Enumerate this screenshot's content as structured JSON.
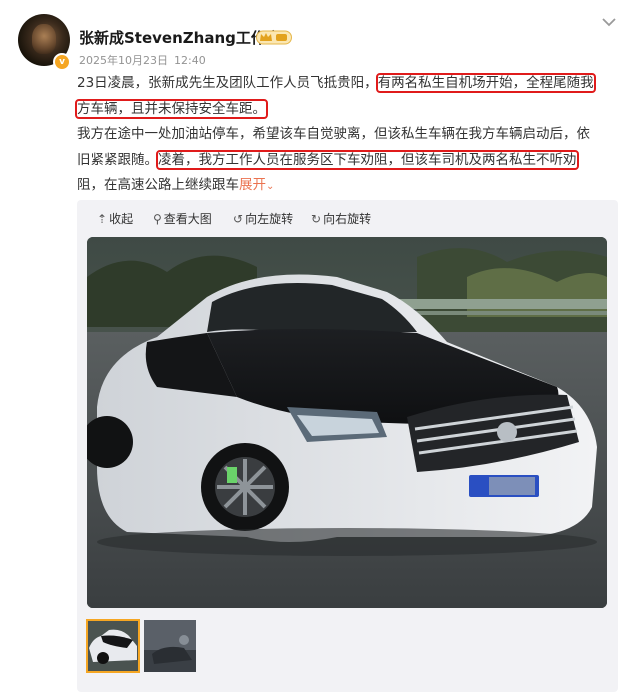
{
  "author": {
    "name": "张新成StevenZhang工作室",
    "vip_badge": "vip-crown-icon",
    "verified_badge": "verified-v-icon"
  },
  "meta": {
    "date": "2025年10月23日",
    "time": "12:40"
  },
  "post": {
    "line1_a": "23日凌晨，张新成先生及团队工作人员飞抵贵阳，",
    "line1_b": "有两名私生自机场开始，全程尾随我",
    "line2_a": "方车辆，且并未保持安全车距。",
    "line3": "我方在途中一处加油站停车，希望该车自觉驶离，但该私生车辆在我方车辆启动后，依",
    "line4_a": "旧紧紧跟随。",
    "line4_b": "凌着，我方工作人员在服务区下车劝阻，但该车司机及两名私生不听劝",
    "line5_a": "阻，在高速公路上继续跟车",
    "expand_label": "展开"
  },
  "toolbar": {
    "collapse": "收起",
    "view_large": "查看大图",
    "rotate_left": "向左旋转",
    "rotate_right": "向右旋转"
  },
  "colors": {
    "highlight": "#e01b1b",
    "expand": "#eb7350",
    "selected_thumb": "#f5a623",
    "media_bg": "#f2f2f5"
  }
}
